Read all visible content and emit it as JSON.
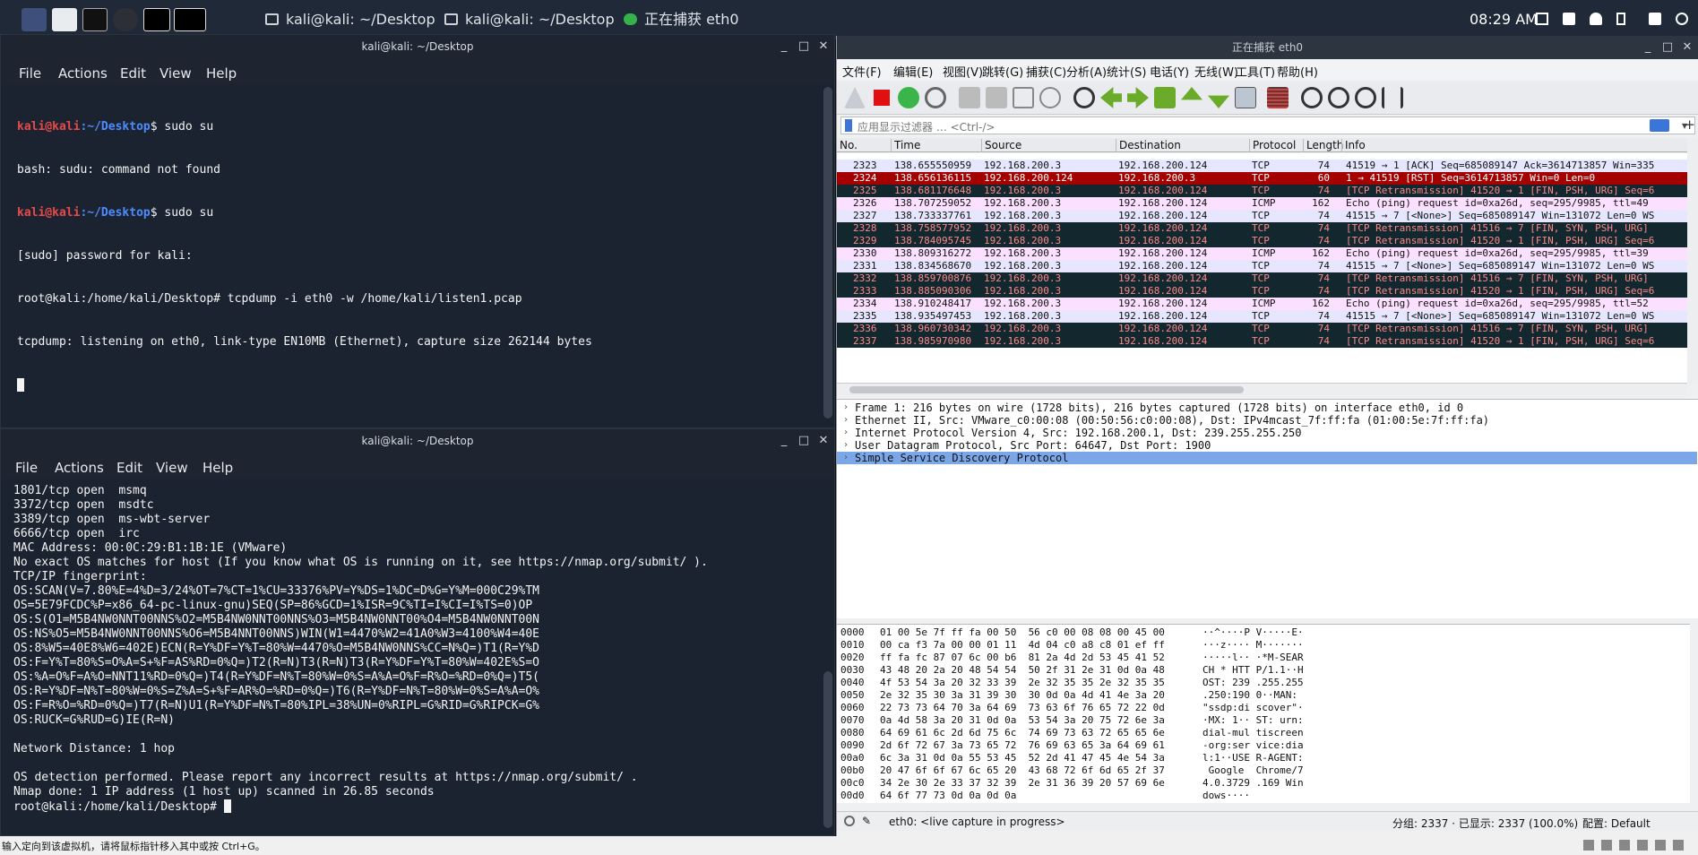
{
  "topbar": {
    "tasks": [
      "kali@kali: ~/Desktop",
      "kali@kali: ~/Desktop",
      "正在捕获 eth0"
    ],
    "clock": "08:29 AM"
  },
  "term1": {
    "title": "kali@kali: ~/Desktop",
    "menu": [
      "File",
      "Actions",
      "Edit",
      "View",
      "Help"
    ],
    "lines": [
      {
        "user": "kali@kali",
        "path": ":~/Desktop",
        "cmd": "$ sudo su"
      },
      {
        "text": "bash: sudu: command not found"
      },
      {
        "user": "kali@kali",
        "path": ":~/Desktop",
        "cmd": "$ sudo su"
      },
      {
        "text": "[sudo] password for kali:"
      },
      {
        "text": "root@kali:/home/kali/Desktop# tcpdump -i eth0 -w /home/kali/listen1.pcap"
      },
      {
        "text": "tcpdump: listening on eth0, link-type EN10MB (Ethernet), capture size 262144 bytes"
      }
    ]
  },
  "term2": {
    "title": "kali@kali: ~/Desktop",
    "menu": [
      "File",
      "Actions",
      "Edit",
      "View",
      "Help"
    ],
    "lines": [
      "1801/tcp open  msmq",
      "3372/tcp open  msdtc",
      "3389/tcp open  ms-wbt-server",
      "6666/tcp open  irc",
      "MAC Address: 00:0C:29:B1:1B:1E (VMware)",
      "No exact OS matches for host (If you know what OS is running on it, see https://nmap.org/submit/ ).",
      "TCP/IP fingerprint:",
      "OS:SCAN(V=7.80%E=4%D=3/24%OT=7%CT=1%CU=33376%PV=Y%DS=1%DC=D%G=Y%M=000C29%TM",
      "OS=5E79FCDC%P=x86_64-pc-linux-gnu)SEQ(SP=86%GCD=1%ISR=9C%TI=I%CI=I%TS=0)OP",
      "OS:S(O1=M5B4NW0NNT00NNS%O2=M5B4NW0NNT00NNS%O3=M5B4NW0NNT00%O4=M5B4NW0NNT00N",
      "OS:NS%O5=M5B4NW0NNT00NNS%O6=M5B4NNT00NNS)WIN(W1=4470%W2=41A0%W3=4100%W4=40E",
      "OS:8%W5=40E8%W6=402E)ECN(R=Y%DF=Y%T=80%W=4470%O=M5B4NW0NNS%CC=N%Q=)T1(R=Y%D",
      "OS:F=Y%T=80%S=O%A=S+%F=AS%RD=0%Q=)T2(R=N)T3(R=N)T3(R=Y%DF=Y%T=80%W=402E%S=O",
      "OS:%A=O%F=A%O=NNT11%RD=0%Q=)T4(R=Y%DF=N%T=80%W=0%S=A%A=O%F=R%O=%RD=0%Q=)T5(",
      "OS:R=Y%DF=N%T=80%W=0%S=Z%A=S+%F=AR%O=%RD=0%Q=)T6(R=Y%DF=N%T=80%W=0%S=A%A=O%",
      "OS:F=R%O=%RD=0%Q=)T7(R=N)U1(R=Y%DF=N%T=80%IPL=38%UN=0%RIPL=G%RID=G%RIPCK=G%",
      "OS:RUCK=G%RUD=G)IE(R=N)",
      "",
      "Network Distance: 1 hop",
      "",
      "OS detection performed. Please report any incorrect results at https://nmap.org/submit/ .",
      "Nmap done: 1 IP address (1 host up) scanned in 26.85 seconds",
      "root@kali:/home/kali/Desktop# "
    ]
  },
  "wireshark": {
    "title": "正在捕获 eth0",
    "menu": [
      "文件(F)",
      "编辑(E)",
      "视图(V)",
      "跳转(G)",
      "捕获(C)",
      "分析(A)",
      "统计(S)",
      "电话(Y)",
      "无线(W)",
      "工具(T)",
      "帮助(H)"
    ],
    "filter_placeholder": "应用显示过滤器 … <Ctrl-/>",
    "columns": [
      "No.",
      "Time",
      "Source",
      "Destination",
      "Protocol",
      "Length",
      "Info"
    ],
    "packets": [
      {
        "no": "2323",
        "time": "138.655550959",
        "src": "192.168.200.3",
        "dst": "192.168.200.124",
        "proto": "TCP",
        "len": "74",
        "info": "41519 → 1 [ACK] Seq=685089147 Ack=3614713857 Win=335",
        "style": "tcp"
      },
      {
        "no": "2324",
        "time": "138.656136115",
        "src": "192.168.200.124",
        "dst": "192.168.200.3",
        "proto": "TCP",
        "len": "60",
        "info": "1 → 41519 [RST] Seq=3614713857 Win=0 Len=0",
        "style": "sel"
      },
      {
        "no": "2325",
        "time": "138.681176648",
        "src": "192.168.200.3",
        "dst": "192.168.200.124",
        "proto": "TCP",
        "len": "74",
        "info": "[TCP Retransmission] 41520 → 1 [FIN, PSH, URG] Seq=6",
        "style": "bad"
      },
      {
        "no": "2326",
        "time": "138.707259052",
        "src": "192.168.200.3",
        "dst": "192.168.200.124",
        "proto": "ICMP",
        "len": "162",
        "info": "Echo (ping) request  id=0xa26d, seq=295/9985, ttl=49",
        "style": "icmp"
      },
      {
        "no": "2327",
        "time": "138.733337761",
        "src": "192.168.200.3",
        "dst": "192.168.200.124",
        "proto": "TCP",
        "len": "74",
        "info": "41515 → 7 [<None>] Seq=685089147 Win=131072 Len=0 WS",
        "style": "tcp"
      },
      {
        "no": "2328",
        "time": "138.758577952",
        "src": "192.168.200.3",
        "dst": "192.168.200.124",
        "proto": "TCP",
        "len": "74",
        "info": "[TCP Retransmission] 41516 → 7 [FIN, SYN, PSH, URG]",
        "style": "bad"
      },
      {
        "no": "2329",
        "time": "138.784095745",
        "src": "192.168.200.3",
        "dst": "192.168.200.124",
        "proto": "TCP",
        "len": "74",
        "info": "[TCP Retransmission] 41520 → 1 [FIN, PSH, URG] Seq=6",
        "style": "bad"
      },
      {
        "no": "2330",
        "time": "138.809316272",
        "src": "192.168.200.3",
        "dst": "192.168.200.124",
        "proto": "ICMP",
        "len": "162",
        "info": "Echo (ping) request  id=0xa26d, seq=295/9985, ttl=39",
        "style": "icmp"
      },
      {
        "no": "2331",
        "time": "138.834568670",
        "src": "192.168.200.3",
        "dst": "192.168.200.124",
        "proto": "TCP",
        "len": "74",
        "info": "41515 → 7 [<None>] Seq=685089147 Win=131072 Len=0 WS",
        "style": "tcp"
      },
      {
        "no": "2332",
        "time": "138.859700876",
        "src": "192.168.200.3",
        "dst": "192.168.200.124",
        "proto": "TCP",
        "len": "74",
        "info": "[TCP Retransmission] 41516 → 7 [FIN, SYN, PSH, URG]",
        "style": "bad"
      },
      {
        "no": "2333",
        "time": "138.885090306",
        "src": "192.168.200.3",
        "dst": "192.168.200.124",
        "proto": "TCP",
        "len": "74",
        "info": "[TCP Retransmission] 41520 → 1 [FIN, PSH, URG] Seq=6",
        "style": "bad"
      },
      {
        "no": "2334",
        "time": "138.910248417",
        "src": "192.168.200.3",
        "dst": "192.168.200.124",
        "proto": "ICMP",
        "len": "162",
        "info": "Echo (ping) request  id=0xa26d, seq=295/9985, ttl=52",
        "style": "icmp"
      },
      {
        "no": "2335",
        "time": "138.935497453",
        "src": "192.168.200.3",
        "dst": "192.168.200.124",
        "proto": "TCP",
        "len": "74",
        "info": "41515 → 7 [<None>] Seq=685089147 Win=131072 Len=0 WS",
        "style": "tcp"
      },
      {
        "no": "2336",
        "time": "138.960730342",
        "src": "192.168.200.3",
        "dst": "192.168.200.124",
        "proto": "TCP",
        "len": "74",
        "info": "[TCP Retransmission] 41516 → 7 [FIN, SYN, PSH, URG]",
        "style": "bad"
      },
      {
        "no": "2337",
        "time": "138.985970980",
        "src": "192.168.200.3",
        "dst": "192.168.200.124",
        "proto": "TCP",
        "len": "74",
        "info": "[TCP Retransmission] 41520 → 1 [FIN, PSH, URG] Seq=6",
        "style": "bad"
      }
    ],
    "details": [
      "Frame 1: 216 bytes on wire (1728 bits), 216 bytes captured (1728 bits) on interface eth0, id 0",
      "Ethernet II, Src: VMware_c0:00:08 (00:50:56:c0:00:08), Dst: IPv4mcast_7f:ff:fa (01:00:5e:7f:ff:fa)",
      "Internet Protocol Version 4, Src: 192.168.200.1, Dst: 239.255.255.250",
      "User Datagram Protocol, Src Port: 64647, Dst Port: 1900",
      "Simple Service Discovery Protocol"
    ],
    "bytes": [
      {
        "off": "0000",
        "hex": "01 00 5e 7f ff fa 00 50  56 c0 00 08 08 00 45 00",
        "ascii": "··^····P V·····E·"
      },
      {
        "off": "0010",
        "hex": "00 ca f3 7a 00 00 01 11  4d 04 c0 a8 c8 01 ef ff",
        "ascii": "···z···· M·······"
      },
      {
        "off": "0020",
        "hex": "ff fa fc 87 07 6c 00 b6  81 2a 4d 2d 53 45 41 52",
        "ascii": "·····l·· ·*M-SEAR"
      },
      {
        "off": "0030",
        "hex": "43 48 20 2a 20 48 54 54  50 2f 31 2e 31 0d 0a 48",
        "ascii": "CH * HTT P/1.1··H"
      },
      {
        "off": "0040",
        "hex": "4f 53 54 3a 20 32 33 39  2e 32 35 35 2e 32 35 35",
        "ascii": "OST: 239 .255.255"
      },
      {
        "off": "0050",
        "hex": "2e 32 35 30 3a 31 39 30  30 0d 0a 4d 41 4e 3a 20",
        "ascii": ".250:190 0··MAN: "
      },
      {
        "off": "0060",
        "hex": "22 73 73 64 70 3a 64 69  73 63 6f 76 65 72 22 0d",
        "ascii": "\"ssdp:di scover\"·"
      },
      {
        "off": "0070",
        "hex": "0a 4d 58 3a 20 31 0d 0a  53 54 3a 20 75 72 6e 3a",
        "ascii": "·MX: 1·· ST: urn:"
      },
      {
        "off": "0080",
        "hex": "64 69 61 6c 2d 6d 75 6c  74 69 73 63 72 65 65 6e",
        "ascii": "dial-mul tiscreen"
      },
      {
        "off": "0090",
        "hex": "2d 6f 72 67 3a 73 65 72  76 69 63 65 3a 64 69 61",
        "ascii": "-org:ser vice:dia"
      },
      {
        "off": "00a0",
        "hex": "6c 3a 31 0d 0a 55 53 45  52 2d 41 47 45 4e 54 3a",
        "ascii": "l:1··USE R-AGENT:"
      },
      {
        "off": "00b0",
        "hex": "20 47 6f 6f 67 6c 65 20  43 68 72 6f 6d 65 2f 37",
        "ascii": " Google  Chrome/7"
      },
      {
        "off": "00c0",
        "hex": "34 2e 30 2e 33 37 32 39  2e 31 36 39 20 57 69 6e",
        "ascii": "4.0.3729 .169 Win"
      },
      {
        "off": "00d0",
        "hex": "64 6f 77 73 0d 0a 0d 0a",
        "ascii": "dows····"
      }
    ],
    "status_interface": "eth0: <live capture in progress>",
    "status_counts": "分组: 2337 · 已显示: 2337 (100.0%)",
    "status_profile": "配置: Default"
  },
  "bottom_hint": "输入定向到该虚拟机，请将鼠标指针移入其中或按 Ctrl+G。",
  "colors": {
    "accent_red": "#a40000",
    "terminal_bg": "#1b2330",
    "prompt_red": "#e84a4a",
    "prompt_blue": "#4d8cff"
  }
}
